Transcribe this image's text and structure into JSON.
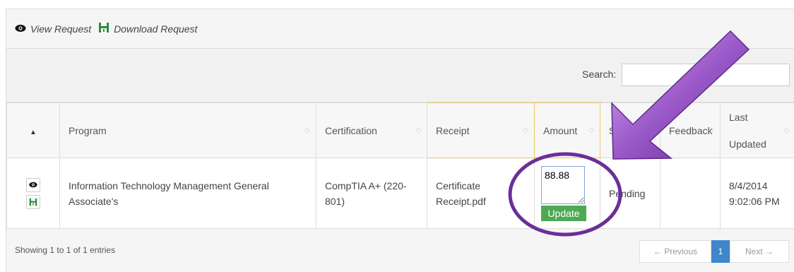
{
  "legend": {
    "view": "View Request",
    "download": "Download Request"
  },
  "search": {
    "label": "Search:",
    "value": ""
  },
  "columns": [
    "Program",
    "Certification",
    "Receipt",
    "Amount",
    "Status",
    "Feedback",
    "Last Updated"
  ],
  "row": {
    "program": "Information Technology Management General Associate's",
    "certification": "CompTIA A+ (220-801)",
    "receipt": "Certificate Receipt.pdf",
    "amount": "88.88",
    "update_label": "Update",
    "status": "Pending",
    "feedback": "",
    "updated_date": "8/4/2014",
    "updated_time": "9:02:06 PM"
  },
  "footer": {
    "info": "Showing 1 to 1 of 1 entries",
    "previous": "← Previous",
    "page": "1",
    "next": "Next →"
  },
  "colors": {
    "update_button": "#4caa52",
    "active_page": "#3f86cc",
    "annotation": "#6b2f99",
    "highlight_border": "#e8c464"
  },
  "icons": [
    "eye-icon",
    "download-icon",
    "arrow-annotation",
    "circle-annotation"
  ]
}
